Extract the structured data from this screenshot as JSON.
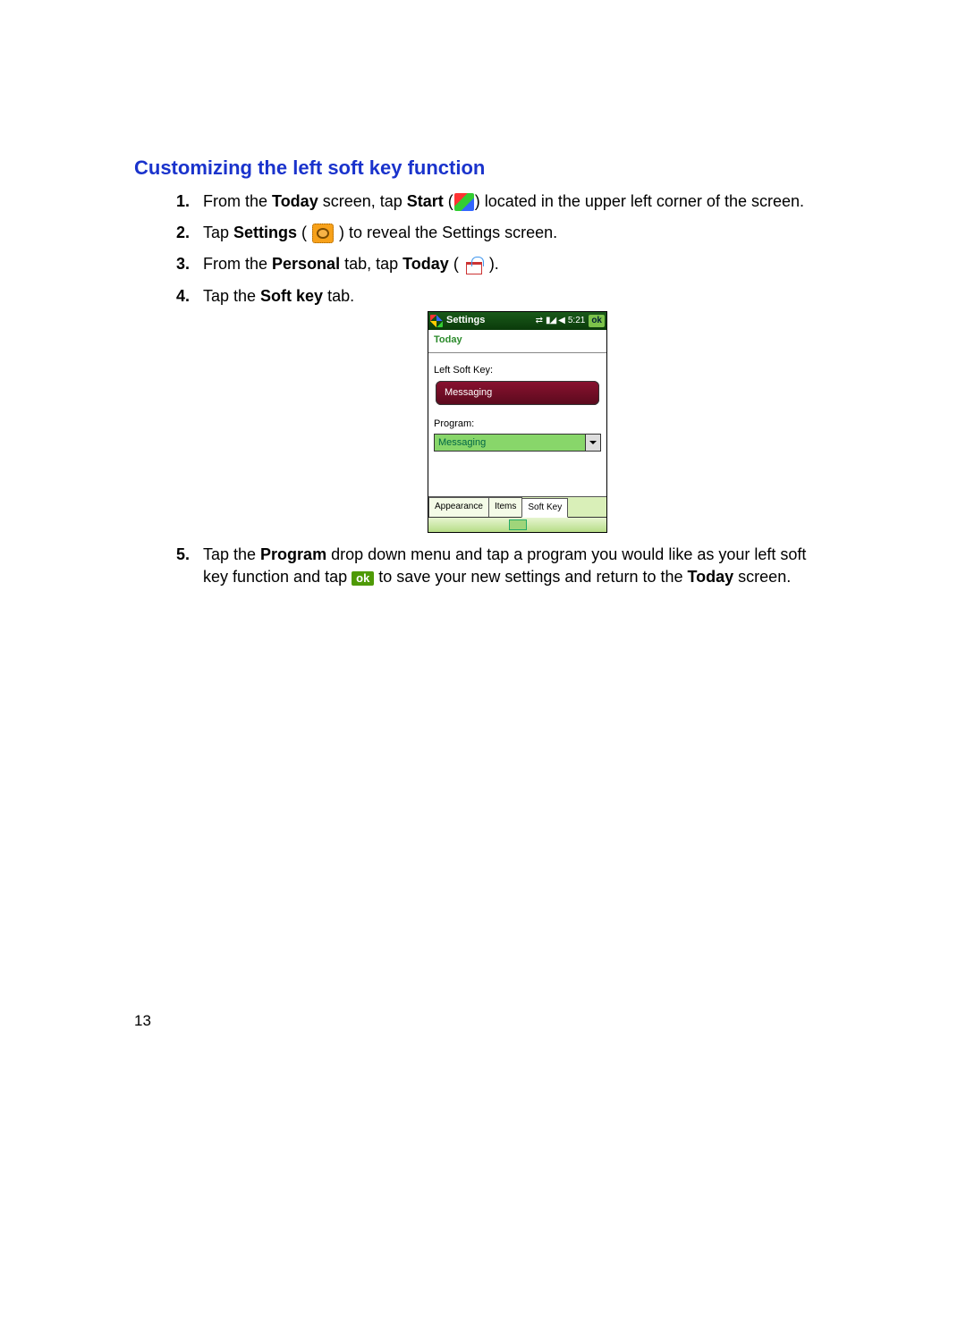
{
  "heading": "Customizing the left soft key function",
  "steps": {
    "s1a": "From the ",
    "s1b": "Today",
    "s1c": " screen, tap ",
    "s1d": "Start",
    "s1e": " (",
    "s1f": ") located in the upper left corner of the screen.",
    "s2a": "Tap ",
    "s2b": "Settings",
    "s2c": " ( ",
    "s2d": " ) to reveal the Settings screen.",
    "s3a": "From the ",
    "s3b": "Personal",
    "s3c": " tab, tap ",
    "s3d": "Today",
    "s3e": " ( ",
    "s3f": " ).",
    "s4a": "Tap the ",
    "s4b": "Soft key",
    "s4c": " tab.",
    "s5a": "Tap the ",
    "s5b": "Program",
    "s5c": " drop down menu and tap a program you would like as your left soft key function and tap ",
    "s5d": " to save your new settings and return to the ",
    "s5e": "Today",
    "s5f": " screen."
  },
  "ok_label": "ok",
  "device": {
    "title": "Settings",
    "time": "5:21",
    "ok": "ok",
    "screen_title": "Today",
    "left_soft_key_label": "Left Soft Key:",
    "soft_button": "Messaging",
    "program_label": "Program:",
    "dropdown_value": "Messaging",
    "tabs": [
      "Appearance",
      "Items",
      "Soft Key"
    ]
  },
  "page_number": "13"
}
